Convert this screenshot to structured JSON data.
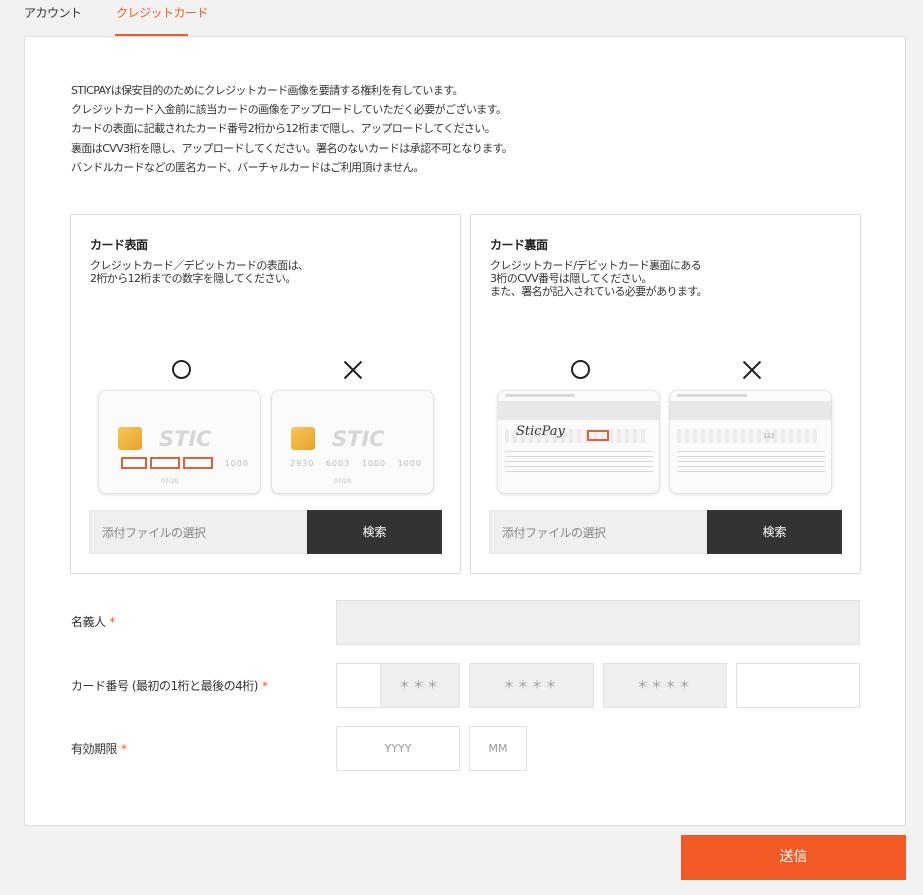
{
  "tabs": {
    "account": "アカウント",
    "credit_card": "クレジットカード"
  },
  "colors": {
    "accent": "#f15a24",
    "dark_button": "#333333"
  },
  "notice": [
    "STICPAYは保安目的のためにクレジットカード画像を要請する権利を有しています。",
    "クレジットカード入金前に該当カードの画像をアップロードしていただく必要がございます。",
    "カードの表面に記載されたカード番号2桁から12桁まで隠し、アップロードしてください。",
    "裏面はCVV3桁を隠し、アップロードしてください。署名のないカードは承認不可となります。",
    "バンドルカードなどの匿名カード、バーチャルカードはご利用頂けません。"
  ],
  "front": {
    "title": "カード表面",
    "desc": [
      "クレジットカード／デビットカードの表面は、",
      "2桁から12桁までの数字を隠してください。"
    ],
    "ok_mark": "ok-circle-icon",
    "ng_mark": "ng-cross-icon",
    "card_brand": "STIC",
    "ok_digits": [
      "",
      "",
      "",
      "1000"
    ],
    "ng_digits": [
      "2930",
      "6003",
      "1000",
      "1000"
    ],
    "expiry": "07/20",
    "file_placeholder": "添付ファイルの選択",
    "browse_label": "検索"
  },
  "back": {
    "title": "カード裏面",
    "desc": [
      "クレジットカード/デビットカード裏面にある",
      "3桁のCVV番号は隠してください。",
      "また、署名が記入されている必要があります。"
    ],
    "ok_mark": "ok-circle-icon",
    "ng_mark": "ng-cross-icon",
    "signature": "SticPay",
    "cvv": "123",
    "file_placeholder": "添付ファイルの選択",
    "browse_label": "検索"
  },
  "form": {
    "holder_label": "名義人",
    "card_number_label": "カード番号 (最初の1桁と最後の4桁)",
    "expiry_label": "有効期限",
    "required_mark": "*",
    "masked": [
      "＊＊＊",
      "＊＊＊＊",
      "＊＊＊＊"
    ],
    "year_placeholder": "YYYY",
    "month_placeholder": "MM"
  },
  "submit_label": "送信"
}
